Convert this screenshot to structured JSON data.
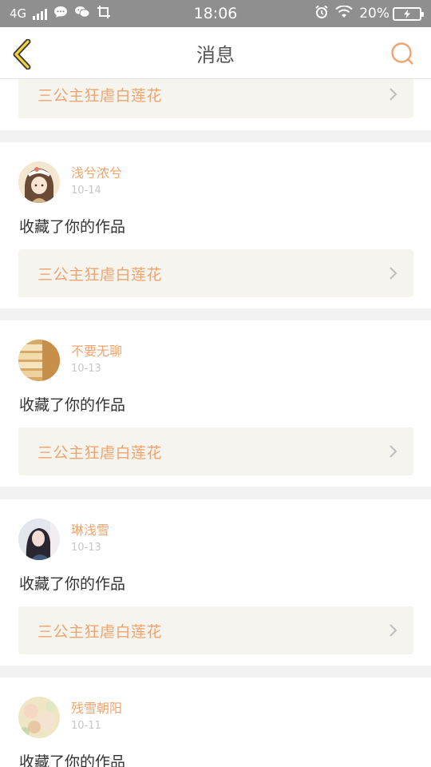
{
  "status_bar": {
    "network": "4G",
    "time": "18:06",
    "battery": "20%"
  },
  "header": {
    "title": "消息"
  },
  "partial_item": {
    "work_title": "三公主狂虐白莲花"
  },
  "messages": [
    {
      "username": "浅兮浓兮",
      "date": "10-14",
      "action": "收藏了你的作品",
      "work_title": "三公主狂虐白莲花"
    },
    {
      "username": "不要无聊",
      "date": "10-13",
      "action": "收藏了你的作品",
      "work_title": "三公主狂虐白莲花"
    },
    {
      "username": "琳浅雪",
      "date": "10-13",
      "action": "收藏了你的作品",
      "work_title": "三公主狂虐白莲花"
    },
    {
      "username": "残雪朝阳",
      "date": "10-11",
      "action": "收藏了你的作品",
      "work_title": ""
    }
  ],
  "colors": {
    "accent": "#f0a46e",
    "back_icon": "#e6b800",
    "status_bar": "#8f8f8f",
    "link_bg": "#f5f4ee"
  },
  "icons": {
    "back": "chevron-left-icon",
    "search": "search-icon",
    "link_arrow": "chevron-right-icon"
  }
}
